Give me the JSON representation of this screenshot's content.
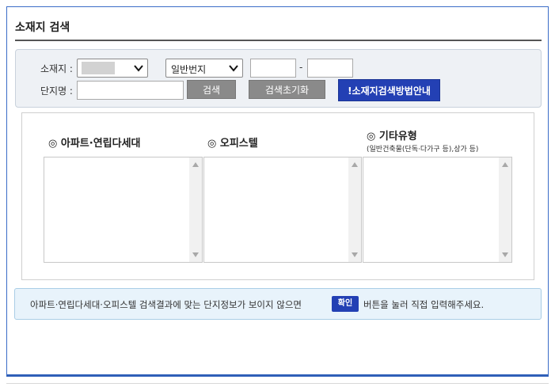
{
  "header": {
    "title": "소재지 검색"
  },
  "search": {
    "location_label": "소재지 :",
    "address_type_selected": "일반번지",
    "hyphen": "-",
    "complex_name_label": "단지명 :",
    "search_button": "검색",
    "reset_button": "검색초기화",
    "guide_button": "!소재지검색방법안내"
  },
  "results": {
    "apartment": {
      "title": "◎ 아파트·연립다세대"
    },
    "officetel": {
      "title": "◎ 오피스텔"
    },
    "other": {
      "title": "◎ 기타유형",
      "subtitle": "(일반건축물(단독·다가구 등),상가 등)"
    }
  },
  "notice": {
    "text_before": "아파트·연립다세대·오피스텔 검색결과에 맞는 단지정보가 보이지 않으면",
    "confirm_button": "확인",
    "text_after": "버튼을 눌러 직접 입력해주세요."
  },
  "colors": {
    "accent_blue": "#2340b4",
    "frame_blue": "#3a6cc7",
    "button_gray": "#8a8a8a"
  }
}
